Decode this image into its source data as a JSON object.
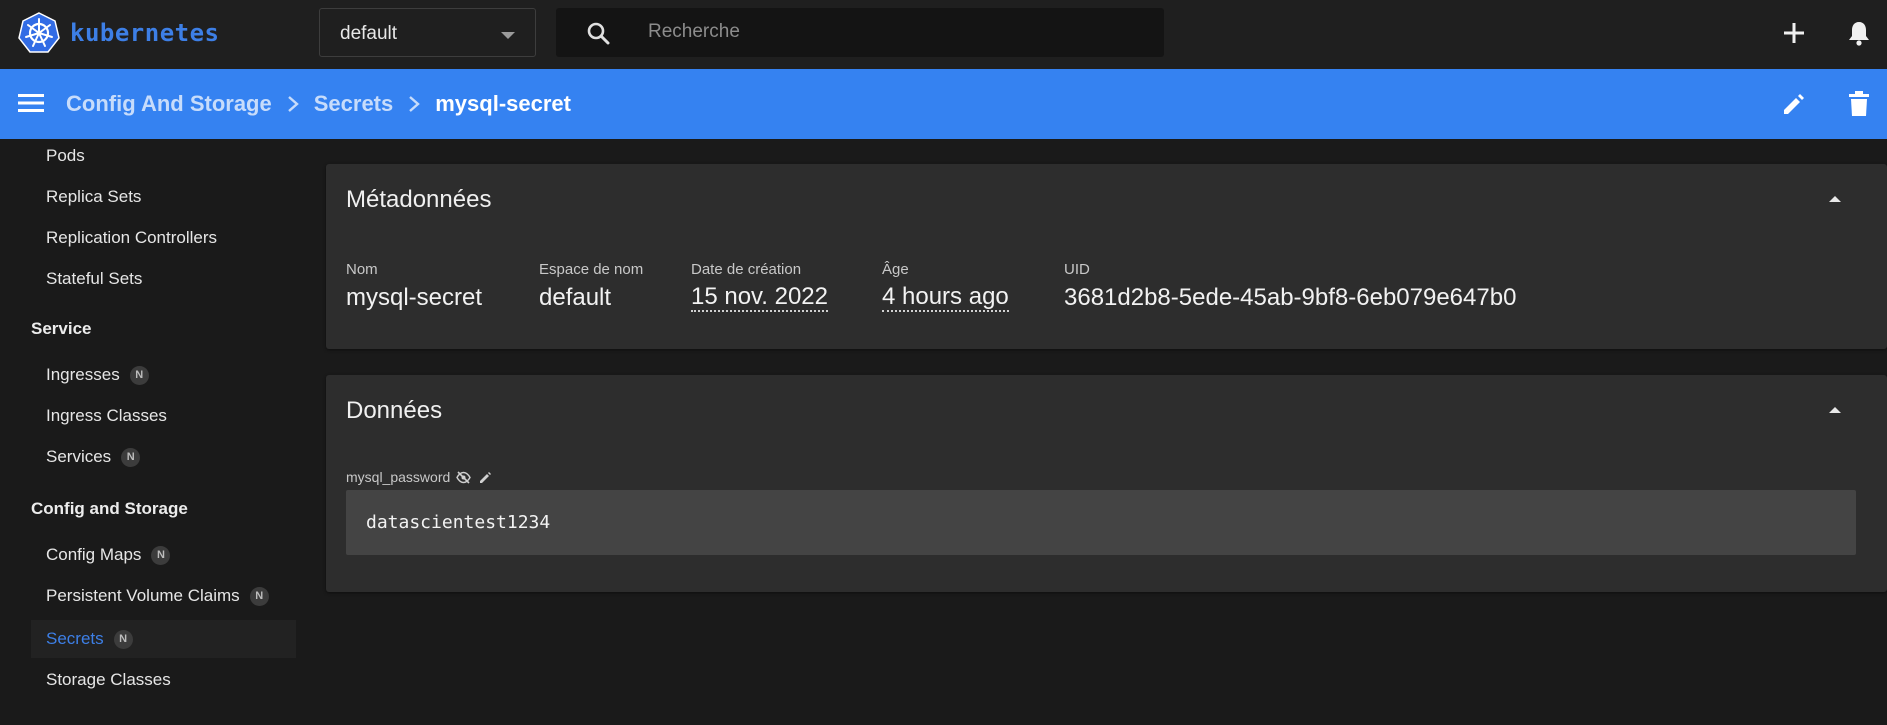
{
  "brand": {
    "name": "kubernetes",
    "color": "#3d7fe6"
  },
  "namespace": {
    "selected": "default"
  },
  "search": {
    "placeholder": "Recherche"
  },
  "toolbar": {
    "add_icon": "plus-icon",
    "notifications_icon": "bell-icon"
  },
  "breadcrumb": {
    "items": [
      "Config And Storage",
      "Secrets"
    ],
    "current": "mysql-secret",
    "edit_icon": "pencil-icon",
    "delete_icon": "trash-icon",
    "bar_color": "#3582f1"
  },
  "sidebar": {
    "workloads": [
      "Pods",
      "Replica Sets",
      "Replication Controllers",
      "Stateful Sets"
    ],
    "service_header": "Service",
    "service": [
      {
        "label": "Ingresses",
        "badge": "N"
      },
      {
        "label": "Ingress Classes"
      },
      {
        "label": "Services",
        "badge": "N"
      }
    ],
    "config_header": "Config and Storage",
    "config": [
      {
        "label": "Config Maps",
        "badge": "N"
      },
      {
        "label": "Persistent Volume Claims",
        "badge": "N"
      },
      {
        "label": "Secrets",
        "badge": "N",
        "active": true
      },
      {
        "label": "Storage Classes"
      }
    ]
  },
  "metadata": {
    "title": "Métadonnées",
    "fields": [
      {
        "label": "Nom",
        "value": "mysql-secret"
      },
      {
        "label": "Espace de nom",
        "value": "default"
      },
      {
        "label": "Date de création",
        "value": "15 nov. 2022"
      },
      {
        "label": "Âge",
        "value": "4 hours ago"
      },
      {
        "label": "UID",
        "value": "3681d2b8-5ede-45ab-9bf8-6eb079e647b0"
      }
    ]
  },
  "data": {
    "title": "Données",
    "key": "mysql_password",
    "value": "datascientest1234"
  }
}
